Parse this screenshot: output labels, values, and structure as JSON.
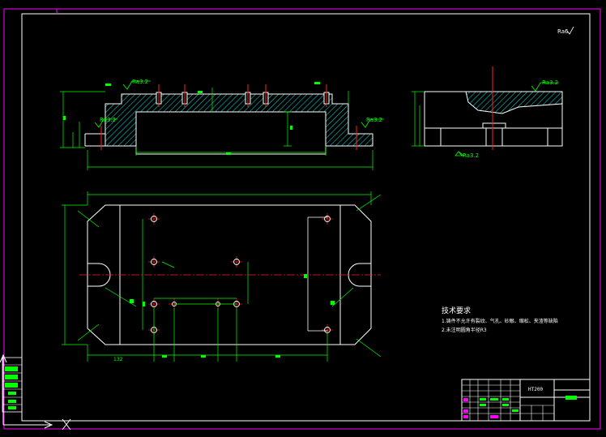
{
  "drawing": {
    "roughness_overall": "Ra6",
    "surface_finish_labels": [
      "Ra3.2",
      "Ra3.2",
      "Ra3.2",
      "Ra3.2",
      "Ra3.2"
    ],
    "tech_requirements": {
      "title": "技术要求",
      "items": [
        "1.铸件不允许有裂纹、气孔、砂眼、缩松、夹渣等缺陷",
        "2.未注明圆角半径R3"
      ]
    },
    "dims": {
      "bottom_left": "132"
    },
    "title_block": {
      "material": "HT200"
    }
  },
  "colors": {
    "background": "#000000",
    "outline": "#ffffff",
    "frame": "#ff00ff",
    "dimension": "#00ff00",
    "centerline": "#ff0000",
    "hatch": "#00ffff",
    "accent_green": "#00ff00",
    "accent_magenta": "#ff00ff"
  }
}
